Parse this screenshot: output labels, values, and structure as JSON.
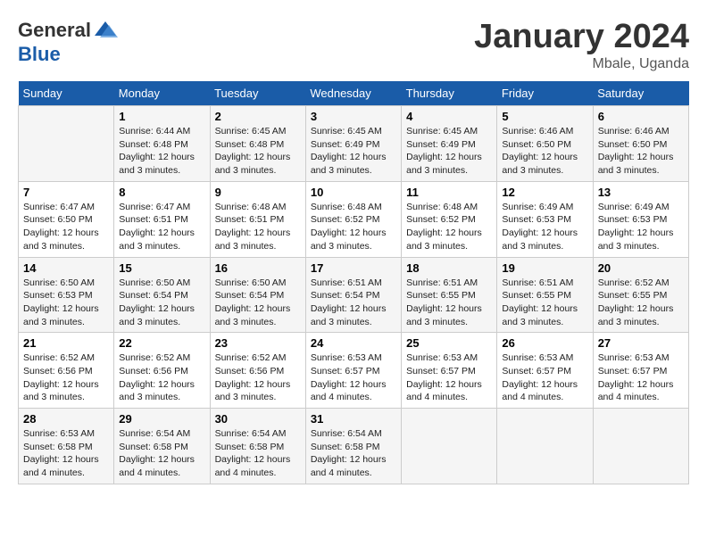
{
  "logo": {
    "general": "General",
    "blue": "Blue"
  },
  "title": "January 2024",
  "subtitle": "Mbale, Uganda",
  "days_header": [
    "Sunday",
    "Monday",
    "Tuesday",
    "Wednesday",
    "Thursday",
    "Friday",
    "Saturday"
  ],
  "weeks": [
    [
      {
        "day": "",
        "sunrise": "",
        "sunset": "",
        "daylight": ""
      },
      {
        "day": "1",
        "sunrise": "Sunrise: 6:44 AM",
        "sunset": "Sunset: 6:48 PM",
        "daylight": "Daylight: 12 hours and 3 minutes."
      },
      {
        "day": "2",
        "sunrise": "Sunrise: 6:45 AM",
        "sunset": "Sunset: 6:48 PM",
        "daylight": "Daylight: 12 hours and 3 minutes."
      },
      {
        "day": "3",
        "sunrise": "Sunrise: 6:45 AM",
        "sunset": "Sunset: 6:49 PM",
        "daylight": "Daylight: 12 hours and 3 minutes."
      },
      {
        "day": "4",
        "sunrise": "Sunrise: 6:45 AM",
        "sunset": "Sunset: 6:49 PM",
        "daylight": "Daylight: 12 hours and 3 minutes."
      },
      {
        "day": "5",
        "sunrise": "Sunrise: 6:46 AM",
        "sunset": "Sunset: 6:50 PM",
        "daylight": "Daylight: 12 hours and 3 minutes."
      },
      {
        "day": "6",
        "sunrise": "Sunrise: 6:46 AM",
        "sunset": "Sunset: 6:50 PM",
        "daylight": "Daylight: 12 hours and 3 minutes."
      }
    ],
    [
      {
        "day": "7",
        "sunrise": "Sunrise: 6:47 AM",
        "sunset": "Sunset: 6:50 PM",
        "daylight": "Daylight: 12 hours and 3 minutes."
      },
      {
        "day": "8",
        "sunrise": "Sunrise: 6:47 AM",
        "sunset": "Sunset: 6:51 PM",
        "daylight": "Daylight: 12 hours and 3 minutes."
      },
      {
        "day": "9",
        "sunrise": "Sunrise: 6:48 AM",
        "sunset": "Sunset: 6:51 PM",
        "daylight": "Daylight: 12 hours and 3 minutes."
      },
      {
        "day": "10",
        "sunrise": "Sunrise: 6:48 AM",
        "sunset": "Sunset: 6:52 PM",
        "daylight": "Daylight: 12 hours and 3 minutes."
      },
      {
        "day": "11",
        "sunrise": "Sunrise: 6:48 AM",
        "sunset": "Sunset: 6:52 PM",
        "daylight": "Daylight: 12 hours and 3 minutes."
      },
      {
        "day": "12",
        "sunrise": "Sunrise: 6:49 AM",
        "sunset": "Sunset: 6:53 PM",
        "daylight": "Daylight: 12 hours and 3 minutes."
      },
      {
        "day": "13",
        "sunrise": "Sunrise: 6:49 AM",
        "sunset": "Sunset: 6:53 PM",
        "daylight": "Daylight: 12 hours and 3 minutes."
      }
    ],
    [
      {
        "day": "14",
        "sunrise": "Sunrise: 6:50 AM",
        "sunset": "Sunset: 6:53 PM",
        "daylight": "Daylight: 12 hours and 3 minutes."
      },
      {
        "day": "15",
        "sunrise": "Sunrise: 6:50 AM",
        "sunset": "Sunset: 6:54 PM",
        "daylight": "Daylight: 12 hours and 3 minutes."
      },
      {
        "day": "16",
        "sunrise": "Sunrise: 6:50 AM",
        "sunset": "Sunset: 6:54 PM",
        "daylight": "Daylight: 12 hours and 3 minutes."
      },
      {
        "day": "17",
        "sunrise": "Sunrise: 6:51 AM",
        "sunset": "Sunset: 6:54 PM",
        "daylight": "Daylight: 12 hours and 3 minutes."
      },
      {
        "day": "18",
        "sunrise": "Sunrise: 6:51 AM",
        "sunset": "Sunset: 6:55 PM",
        "daylight": "Daylight: 12 hours and 3 minutes."
      },
      {
        "day": "19",
        "sunrise": "Sunrise: 6:51 AM",
        "sunset": "Sunset: 6:55 PM",
        "daylight": "Daylight: 12 hours and 3 minutes."
      },
      {
        "day": "20",
        "sunrise": "Sunrise: 6:52 AM",
        "sunset": "Sunset: 6:55 PM",
        "daylight": "Daylight: 12 hours and 3 minutes."
      }
    ],
    [
      {
        "day": "21",
        "sunrise": "Sunrise: 6:52 AM",
        "sunset": "Sunset: 6:56 PM",
        "daylight": "Daylight: 12 hours and 3 minutes."
      },
      {
        "day": "22",
        "sunrise": "Sunrise: 6:52 AM",
        "sunset": "Sunset: 6:56 PM",
        "daylight": "Daylight: 12 hours and 3 minutes."
      },
      {
        "day": "23",
        "sunrise": "Sunrise: 6:52 AM",
        "sunset": "Sunset: 6:56 PM",
        "daylight": "Daylight: 12 hours and 3 minutes."
      },
      {
        "day": "24",
        "sunrise": "Sunrise: 6:53 AM",
        "sunset": "Sunset: 6:57 PM",
        "daylight": "Daylight: 12 hours and 4 minutes."
      },
      {
        "day": "25",
        "sunrise": "Sunrise: 6:53 AM",
        "sunset": "Sunset: 6:57 PM",
        "daylight": "Daylight: 12 hours and 4 minutes."
      },
      {
        "day": "26",
        "sunrise": "Sunrise: 6:53 AM",
        "sunset": "Sunset: 6:57 PM",
        "daylight": "Daylight: 12 hours and 4 minutes."
      },
      {
        "day": "27",
        "sunrise": "Sunrise: 6:53 AM",
        "sunset": "Sunset: 6:57 PM",
        "daylight": "Daylight: 12 hours and 4 minutes."
      }
    ],
    [
      {
        "day": "28",
        "sunrise": "Sunrise: 6:53 AM",
        "sunset": "Sunset: 6:58 PM",
        "daylight": "Daylight: 12 hours and 4 minutes."
      },
      {
        "day": "29",
        "sunrise": "Sunrise: 6:54 AM",
        "sunset": "Sunset: 6:58 PM",
        "daylight": "Daylight: 12 hours and 4 minutes."
      },
      {
        "day": "30",
        "sunrise": "Sunrise: 6:54 AM",
        "sunset": "Sunset: 6:58 PM",
        "daylight": "Daylight: 12 hours and 4 minutes."
      },
      {
        "day": "31",
        "sunrise": "Sunrise: 6:54 AM",
        "sunset": "Sunset: 6:58 PM",
        "daylight": "Daylight: 12 hours and 4 minutes."
      },
      {
        "day": "",
        "sunrise": "",
        "sunset": "",
        "daylight": ""
      },
      {
        "day": "",
        "sunrise": "",
        "sunset": "",
        "daylight": ""
      },
      {
        "day": "",
        "sunrise": "",
        "sunset": "",
        "daylight": ""
      }
    ]
  ]
}
